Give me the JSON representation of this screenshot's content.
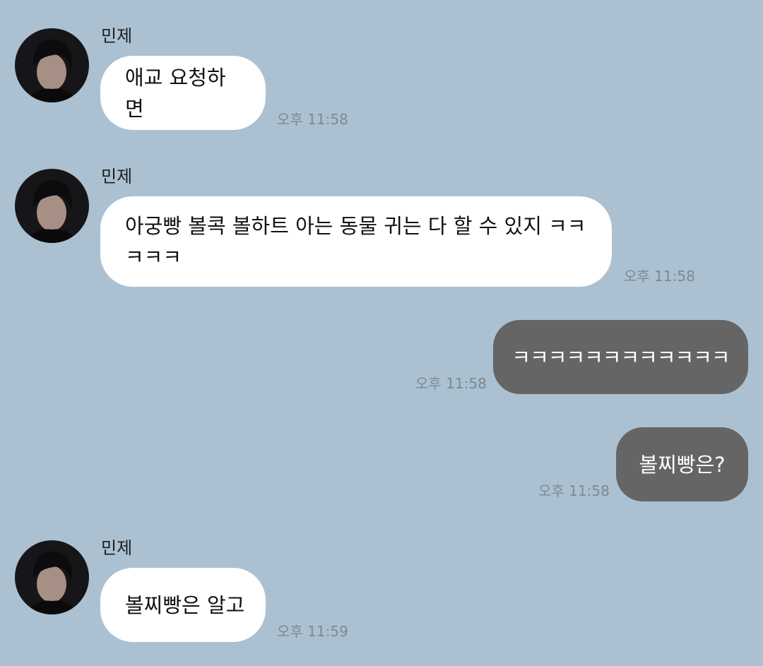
{
  "messages": [
    {
      "sender": "민제",
      "text": "애교 요청하면",
      "time": "오후 11:58",
      "direction": "incoming"
    },
    {
      "sender": "민제",
      "text_line1": "아궁빵 볼콕 볼하트 아는 동물 귀는 다 할 수 있지 ㅋㅋ",
      "text_line2": "ㅋㅋㅋ",
      "time": "오후 11:58",
      "direction": "incoming"
    },
    {
      "text": "ㅋㅋㅋㅋㅋㅋㅋㅋㅋㅋㅋㅋ",
      "time": "오후 11:58",
      "direction": "outgoing"
    },
    {
      "text": "볼찌빵은?",
      "time": "오후 11:58",
      "direction": "outgoing"
    },
    {
      "sender": "민제",
      "text": "볼찌빵은 알고",
      "time": "오후 11:59",
      "direction": "incoming"
    }
  ],
  "colors": {
    "background": "#abc1d1",
    "incoming_bubble": "#ffffff",
    "outgoing_bubble": "#656565",
    "timestamp": "#7b8995"
  },
  "icons": {
    "avatar": "profile-photo-avatar"
  }
}
